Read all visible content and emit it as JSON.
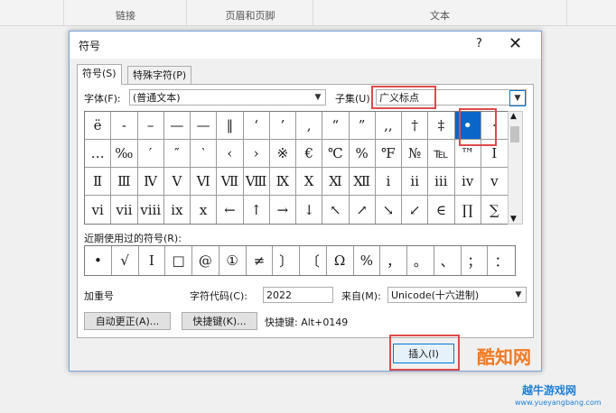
{
  "ribbon": {
    "groups": [
      "链接",
      "页眉和页脚",
      "文本"
    ]
  },
  "dialog": {
    "title": "符号",
    "help_label": "?",
    "close_label": "✕",
    "tabs": [
      "符号(S)",
      "特殊字符(P)"
    ],
    "font_label": "字体(F):",
    "font_value": "(普通文本)",
    "subset_label": "子集(U)",
    "subset_value": "广义标点",
    "symbols": [
      [
        "ë",
        "-",
        "–",
        "—",
        "—",
        "‖",
        "‘",
        "’",
        ",",
        "“",
        "”",
        ",,",
        "†",
        "‡",
        "•",
        "·"
      ],
      [
        "…",
        "‰",
        "′",
        "″",
        "‵",
        "‹",
        "›",
        "※",
        "€",
        "℃",
        "%",
        "℉",
        "№",
        "℡",
        "™",
        "Ⅰ"
      ],
      [
        "Ⅱ",
        "Ⅲ",
        "Ⅳ",
        "Ⅴ",
        "Ⅵ",
        "Ⅶ",
        "Ⅷ",
        "Ⅸ",
        "Ⅹ",
        "Ⅺ",
        "Ⅻ",
        "ⅰ",
        "ⅱ",
        "ⅲ",
        "ⅳ",
        "ⅴ"
      ],
      [
        "ⅵ",
        "ⅶ",
        "ⅷ",
        "ⅸ",
        "ⅹ",
        "←",
        "↑",
        "→",
        "↓",
        "↖",
        "↗",
        "↘",
        "↙",
        "∈",
        "∏",
        "∑"
      ]
    ],
    "recent_label": "近期使用过的符号(R):",
    "recent_symbols": [
      "•",
      "√",
      "Ⅰ",
      "□",
      "@",
      "①",
      "≠",
      "〕",
      "〔",
      "Ω",
      "%",
      "，",
      "。",
      "、",
      "；",
      "："
    ],
    "char_name": "加重号",
    "char_code_label": "字符代码(C):",
    "char_code_value": "2022",
    "from_label": "来自(M):",
    "from_value": "Unicode(十六进制)",
    "autocorrect_label": "自动更正(A)...",
    "shortcut_key_label": "快捷键(K)...",
    "shortcut_text": "快捷键: Alt+0149",
    "insert_label": "插入(I)"
  },
  "watermark": {
    "brand": "酷知网",
    "site_name": "越牛游戏网",
    "site_url": "www.yueyangbang.com"
  },
  "colors": {
    "highlight": "#e04a4a",
    "selected": "#0a66c8",
    "accent": "#0078d7"
  }
}
